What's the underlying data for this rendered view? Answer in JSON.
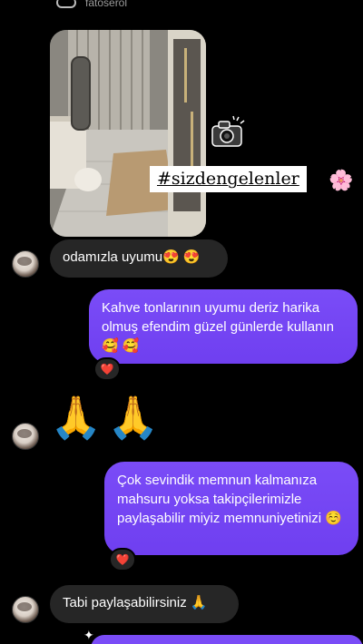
{
  "header": {
    "username": "fatoserol"
  },
  "story": {
    "hashtag": "#sizdengelenler",
    "camera_icon": "camera-icon",
    "flower_icon": "cherry-blossom-icon",
    "flower_glyph": "🌸"
  },
  "messages": [
    {
      "id": "m1",
      "side": "in",
      "text": "odamızla uyumu😍 😍"
    },
    {
      "id": "m2",
      "side": "out",
      "text": "Kahve tonlarının uyumu deriz harika olmuş efendim güzel günlerde kullanın🥰 🥰",
      "reaction": "❤️"
    },
    {
      "id": "m3",
      "side": "in",
      "text": "🙏🙏"
    },
    {
      "id": "m4",
      "side": "out",
      "text": "Çok sevindik memnun kalmanıza mahsuru yoksa takipçilerimizle paylaşabilir miyiz memnuniyetinizi ☺️",
      "reaction": "❤️"
    },
    {
      "id": "m5",
      "side": "in",
      "text": "Tabi paylaşabilirsiniz 🙏"
    }
  ],
  "colors": {
    "background": "#000000",
    "incoming": "#262626",
    "outgoing": "#7a4cf7"
  }
}
